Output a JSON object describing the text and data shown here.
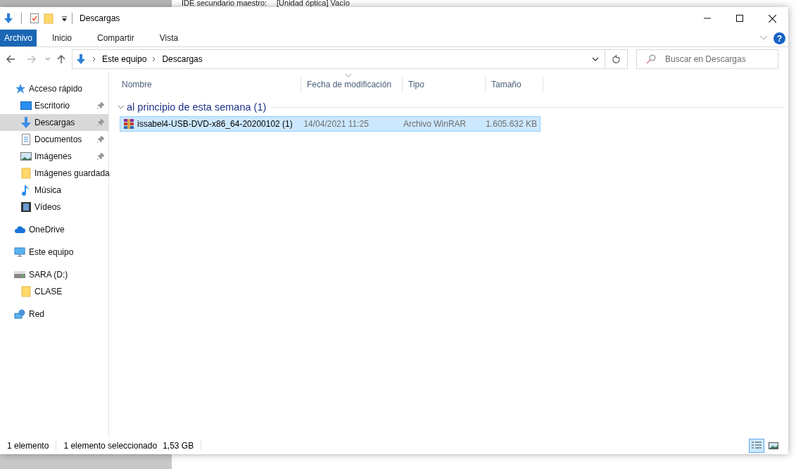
{
  "background": {
    "texts": [
      "IDE secundario maestro:",
      "[Unidad óptica] Vacío"
    ]
  },
  "window": {
    "title": "Descargas"
  },
  "ribbon": {
    "tabs": [
      {
        "label": "Archivo",
        "selected": true
      },
      {
        "label": "Inicio",
        "selected": false
      },
      {
        "label": "Compartir",
        "selected": false
      },
      {
        "label": "Vista",
        "selected": false
      }
    ],
    "help": "?"
  },
  "address": {
    "crumbs": [
      "Este equipo",
      "Descargas"
    ]
  },
  "search": {
    "placeholder": "Buscar en Descargas"
  },
  "sidebar": {
    "items": [
      {
        "kind": "star",
        "label": "Acceso rápido",
        "selected": false,
        "children": [
          {
            "kind": "desktop",
            "label": "Escritorio",
            "pinned": true,
            "selected": false
          },
          {
            "kind": "download",
            "label": "Descargas",
            "pinned": true,
            "selected": true
          },
          {
            "kind": "document",
            "label": "Documentos",
            "pinned": true,
            "selected": false
          },
          {
            "kind": "pictures",
            "label": "Imágenes",
            "pinned": true,
            "selected": false
          },
          {
            "kind": "folder",
            "label": "Imágenes guardada",
            "pinned": false,
            "selected": false
          },
          {
            "kind": "music",
            "label": "Música",
            "pinned": false,
            "selected": false
          },
          {
            "kind": "video",
            "label": "Vídeos",
            "pinned": false,
            "selected": false
          }
        ]
      },
      {
        "kind": "cloud",
        "label": "OneDrive",
        "selected": false
      },
      {
        "kind": "computer",
        "label": "Este equipo",
        "selected": false
      },
      {
        "kind": "drive",
        "label": "SARA (D:)",
        "selected": false,
        "children": [
          {
            "kind": "folder",
            "label": "CLASE",
            "pinned": false,
            "selected": false
          }
        ]
      },
      {
        "kind": "network",
        "label": "Red",
        "selected": false
      }
    ]
  },
  "table": {
    "columns": [
      {
        "label": "Nombre",
        "sorted": false
      },
      {
        "label": "Fecha de modificación",
        "sorted": true
      },
      {
        "label": "Tipo",
        "sorted": false
      },
      {
        "label": "Tamaño",
        "sorted": false
      }
    ],
    "groups": [
      {
        "label": "al principio de esta semana (1)",
        "expanded": true,
        "rows": [
          {
            "selected": true,
            "cells": [
              "issabel4-USB-DVD-x86_64-20200102 (1)",
              "14/04/2021 11:25",
              "Archivo WinRAR",
              "1.605.632 KB"
            ]
          }
        ]
      }
    ]
  },
  "status_bar": {
    "count": "1 elemento",
    "selection": "1 elemento seleccionado",
    "size": "1,53 GB",
    "views": [
      {
        "kind": "details",
        "selected": true
      },
      {
        "kind": "large-icons",
        "selected": false
      }
    ]
  }
}
